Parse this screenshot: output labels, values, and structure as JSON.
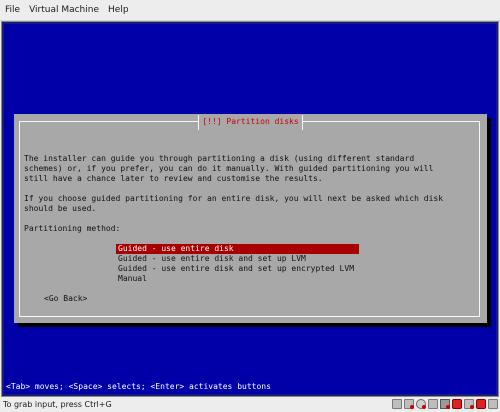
{
  "menubar": {
    "items": [
      "File",
      "Virtual Machine",
      "Help"
    ]
  },
  "dialog": {
    "title": "[!!] Partition disks",
    "paragraph1": [
      "The installer can guide you through partitioning a disk (using different standard",
      "schemes) or, if you prefer, you can do it manually. With guided partitioning you will",
      "still have a chance later to review and customise the results."
    ],
    "paragraph2": [
      "If you choose guided partitioning for an entire disk, you will next be asked which disk",
      "should be used."
    ],
    "method_label": "Partitioning method:",
    "options": [
      "Guided - use entire disk",
      "Guided - use entire disk and set up LVM",
      "Guided - use entire disk and set up encrypted LVM",
      "Manual"
    ],
    "selected_index": 0,
    "go_back_label": "<Go Back>"
  },
  "help_line": "<Tab> moves; <Space> selects; <Enter> activates buttons",
  "statusbar": {
    "text": "To grab input, press Ctrl+G"
  },
  "colors": {
    "screen_bg": "#0000a8",
    "dialog_bg": "#a8a8a8",
    "title_fg": "#c80000",
    "selected_bg": "#a80000"
  },
  "status_icons": [
    "cdrom-icon",
    "usb-icon",
    "floppy-icon",
    "audio-icon",
    "network-icon",
    "display-icon",
    "hdd-icon",
    "printer-icon",
    "message-icon"
  ]
}
